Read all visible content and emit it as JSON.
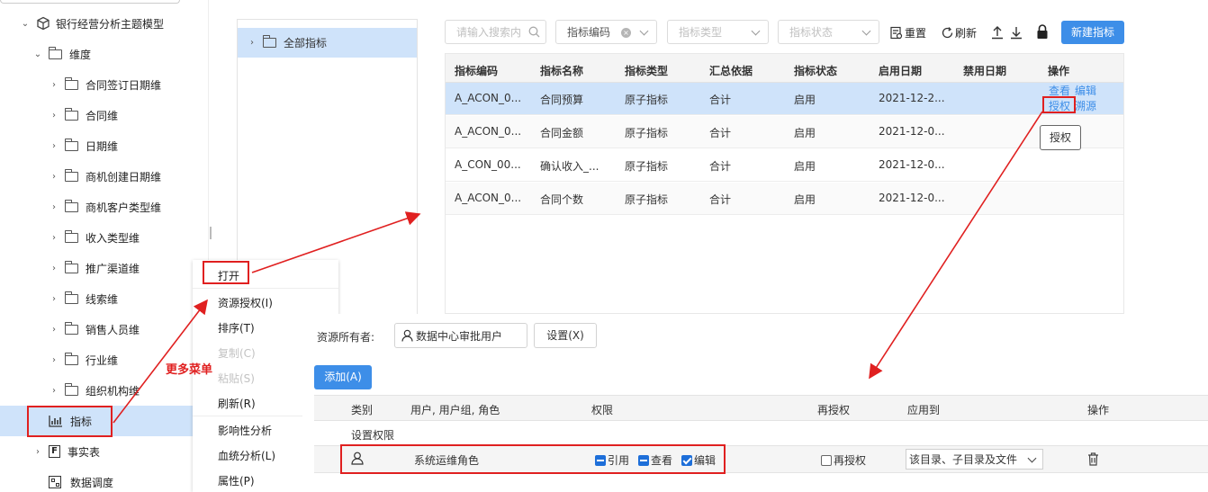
{
  "tree": {
    "root": "银行经营分析主题模型",
    "dimension": "维度",
    "dimensions": [
      "合同签订日期维",
      "合同维",
      "日期维",
      "商机创建日期维",
      "商机客户类型维",
      "收入类型维",
      "推广渠道维",
      "线索维",
      "销售人员维",
      "行业维",
      "组织机构维"
    ],
    "indicator": "指标",
    "fact_table": "事实表",
    "data_schedule": "数据调度"
  },
  "folder_tree": {
    "all": "全部指标"
  },
  "toolbar": {
    "search_placeholder": "请输入搜索内",
    "filter_code": "指标编码",
    "filter_type": "指标类型",
    "filter_status": "指标状态",
    "reset": "重置",
    "refresh": "刷新",
    "new_button": "新建指标"
  },
  "table": {
    "headers": [
      "指标编码",
      "指标名称",
      "指标类型",
      "汇总依据",
      "指标状态",
      "启用日期",
      "禁用日期",
      "操作"
    ],
    "rows": [
      {
        "code": "A_ACON_0...",
        "name": "合同预算",
        "type": "原子指标",
        "agg": "合计",
        "status": "启用",
        "start": "2021-12-2...",
        "end": ""
      },
      {
        "code": "A_ACON_0...",
        "name": "合同金额",
        "type": "原子指标",
        "agg": "合计",
        "status": "启用",
        "start": "2021-12-0...",
        "end": ""
      },
      {
        "code": "A_CON_00...",
        "name": "确认收入_...",
        "type": "原子指标",
        "agg": "合计",
        "status": "启用",
        "start": "2021-12-0...",
        "end": ""
      },
      {
        "code": "A_ACON_0...",
        "name": "合同个数",
        "type": "原子指标",
        "agg": "合计",
        "status": "启用",
        "start": "2021-12-0...",
        "end": ""
      }
    ],
    "ops": {
      "view": "查看",
      "edit": "编辑",
      "grant": "授权",
      "trace": "溯源"
    },
    "tooltip": "授权"
  },
  "context_menu": {
    "items": [
      {
        "label": "打开",
        "disabled": false
      },
      {
        "label": "资源授权(I)",
        "disabled": false
      },
      {
        "label": "排序(T)",
        "disabled": false
      },
      {
        "label": "复制(C)",
        "disabled": true
      },
      {
        "label": "粘贴(S)",
        "disabled": true
      },
      {
        "label": "刷新(R)",
        "disabled": false
      },
      {
        "label": "影响性分析",
        "disabled": false
      },
      {
        "label": "血统分析(L)",
        "disabled": false
      },
      {
        "label": "属性(P)",
        "disabled": false
      }
    ]
  },
  "annotation": "更多菜单",
  "permission": {
    "owner_label": "资源所有者:",
    "owner_value": "数据中心审批用户",
    "set_button": "设置(X)",
    "add_button": "添加(A)",
    "headers": {
      "category": "类别",
      "user": "用户, 用户组, 角色",
      "perm": "权限",
      "regrant": "再授权",
      "apply": "应用到",
      "op": "操作"
    },
    "group_label": "设置权限",
    "row": {
      "name": "系统运维角色",
      "perm_ref": "引用",
      "perm_view": "查看",
      "perm_edit": "编辑",
      "regrant": "再授权",
      "apply_to": "该目录、子目录及文件"
    }
  },
  "colors": {
    "accent": "#3d8ee8",
    "selected_row": "#cfe3fa",
    "annotation_red": "#e02020"
  }
}
